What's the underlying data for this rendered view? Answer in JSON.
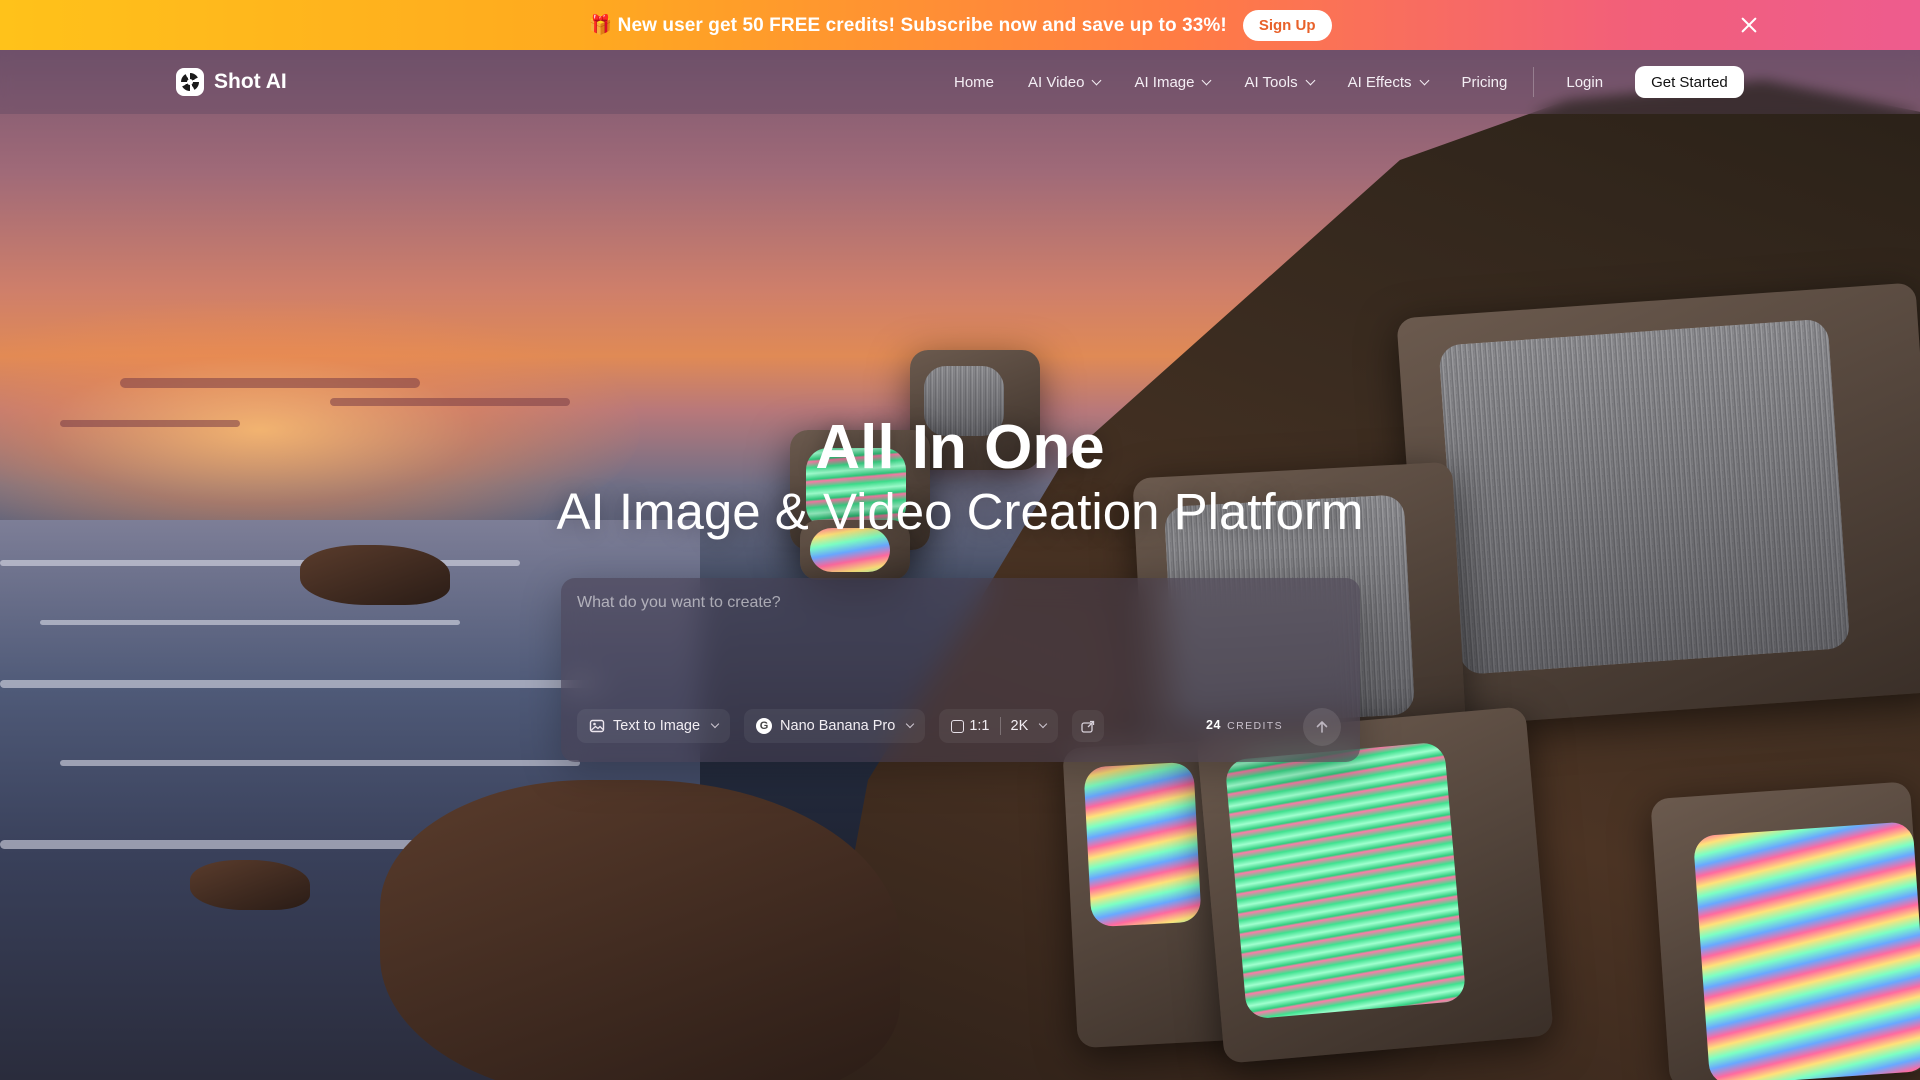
{
  "promo": {
    "icon": "gift-icon",
    "text": "🎁 New user get 50 FREE credits!  Subscribe now and save up to 33%!",
    "cta": "Sign Up"
  },
  "nav": {
    "brand": "Shot AI",
    "links": [
      "Home",
      "AI Video",
      "AI Image",
      "AI Tools",
      "AI Effects",
      "Pricing"
    ],
    "login": "Login",
    "cta": "Get Started"
  },
  "hero": {
    "title": "All In One",
    "subtitle": "AI Image & Video Creation Platform"
  },
  "prompt": {
    "placeholder": "What do you want to create?",
    "mode": "Text to Image",
    "model": "Nano Banana Pro",
    "ratio": "1:1",
    "resolution": "2K",
    "credits_value": "24",
    "credits_label": "CREDITS"
  },
  "colors": {
    "promo_start": "#ffc21a",
    "promo_end": "#ee5c8e",
    "cta_bg": "#ffffff"
  }
}
